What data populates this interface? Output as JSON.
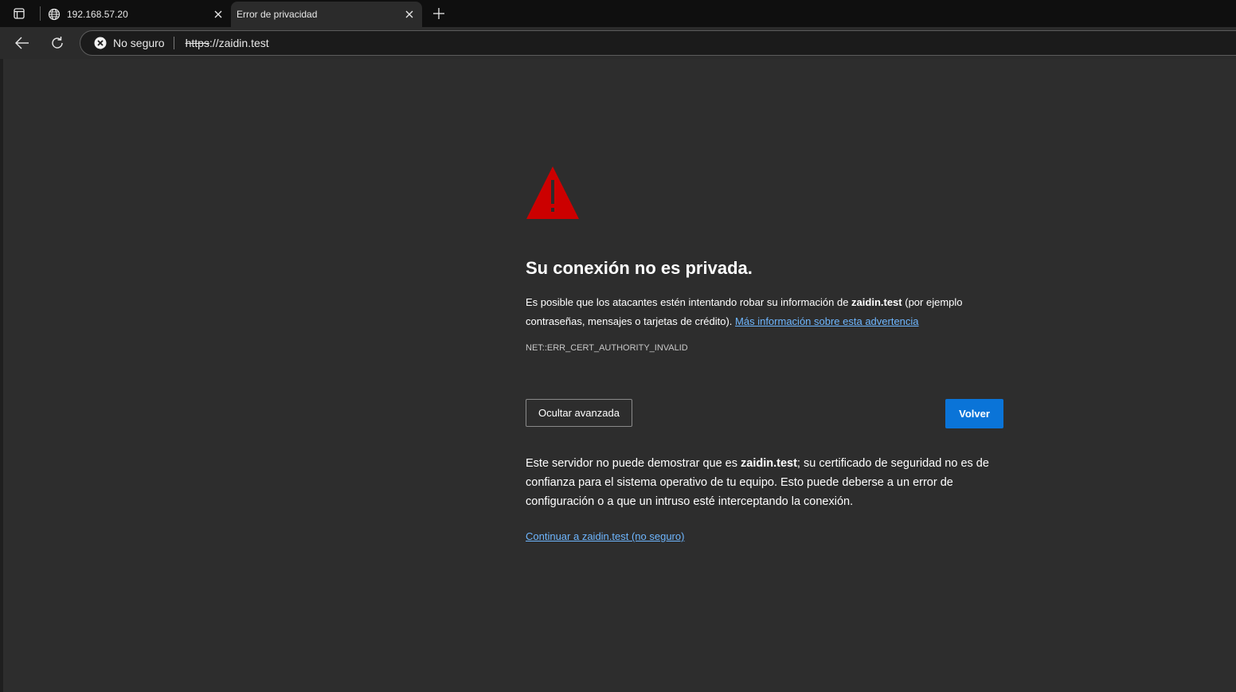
{
  "tabs": [
    {
      "title": "192.168.57.20",
      "favicon": "globe-icon",
      "active": false
    },
    {
      "title": "Error de privacidad",
      "favicon": null,
      "active": true
    }
  ],
  "address_bar": {
    "security_label": "No seguro",
    "url_scheme": "https",
    "url_rest": "://zaidin.test"
  },
  "page": {
    "heading": "Su conexión no es privada.",
    "desc_part1": "Es posible que los atacantes estén intentando robar su información de ",
    "desc_host": "zaidin.test",
    "desc_part2": " (por ejemplo contraseñas, mensajes o tarjetas de crédito). ",
    "learn_more_link": "Más información sobre esta advertencia",
    "error_code": "NET::ERR_CERT_AUTHORITY_INVALID",
    "advanced_button": "Ocultar avanzada",
    "back_button": "Volver",
    "detail_part1": "Este servidor no puede demostrar que es ",
    "detail_host": "zaidin.test",
    "detail_part2": "; su certificado de seguridad no es de confianza para el sistema operativo de tu equipo. Esto puede deberse a un error de configuración o a que un intruso esté interceptando la conexión.",
    "proceed_link": "Continuar a zaidin.test (no seguro)"
  },
  "colors": {
    "warning": "#cc0000",
    "link": "#6eb6ff",
    "primary_button": "#0a74d8"
  }
}
